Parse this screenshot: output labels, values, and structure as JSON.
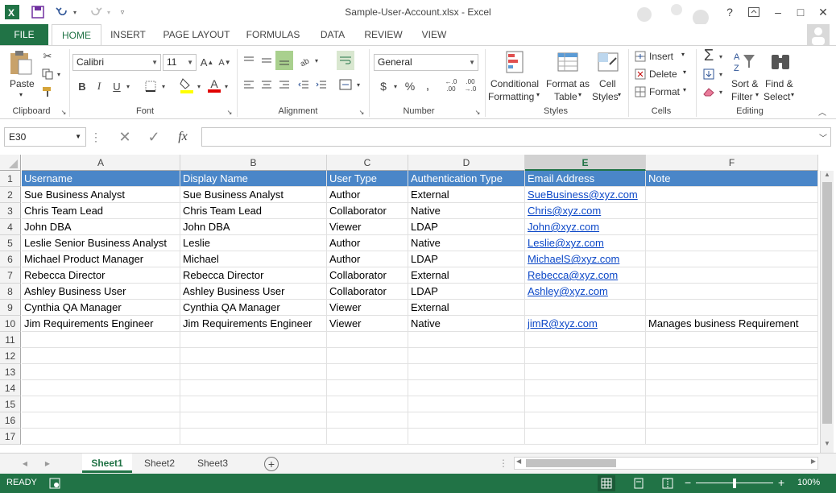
{
  "window": {
    "title": "Sample-User-Account.xlsx - Excel",
    "help_label": "?",
    "minimize_label": "–",
    "restore_label": "□",
    "close_label": "✕"
  },
  "qat": {
    "save_icon": "save-icon",
    "undo_icon": "undo-icon",
    "redo_icon": "redo-icon"
  },
  "ribbon_tabs": {
    "file": "FILE",
    "tabs": [
      "HOME",
      "INSERT",
      "PAGE LAYOUT",
      "FORMULAS",
      "DATA",
      "REVIEW",
      "VIEW"
    ]
  },
  "ribbon": {
    "clipboard": {
      "paste_label": "Paste",
      "group_label": "Clipboard"
    },
    "font": {
      "font_name": "Calibri",
      "font_size": "11",
      "bold": "B",
      "italic": "I",
      "underline": "U",
      "grow": "A",
      "shrink": "A",
      "font_color": "A",
      "group_label": "Font"
    },
    "alignment": {
      "group_label": "Alignment"
    },
    "number": {
      "format": "General",
      "currency": "$",
      "percent": "%",
      "comma": ",",
      "group_label": "Number"
    },
    "styles": {
      "conditional_line1": "Conditional",
      "conditional_line2": "Formatting",
      "format_table_line1": "Format as",
      "format_table_line2": "Table",
      "cell_styles_line1": "Cell",
      "cell_styles_line2": "Styles",
      "group_label": "Styles"
    },
    "cells": {
      "insert": "Insert",
      "delete": "Delete",
      "format": "Format",
      "group_label": "Cells"
    },
    "editing": {
      "sort_line1": "Sort &",
      "sort_line2": "Filter",
      "find_line1": "Find &",
      "find_line2": "Select",
      "group_label": "Editing"
    }
  },
  "formula_bar": {
    "name_box": "E30",
    "fx_label": "fx",
    "formula": ""
  },
  "grid": {
    "columns": [
      "A",
      "B",
      "C",
      "D",
      "E",
      "F"
    ],
    "selected_column": "E",
    "rows": [
      "1",
      "2",
      "3",
      "4",
      "5",
      "6",
      "7",
      "8",
      "9",
      "10",
      "11",
      "12",
      "13",
      "14",
      "15",
      "16",
      "17"
    ],
    "header_row": [
      "Username",
      "Display Name",
      "User Type",
      "Authentication Type",
      "Email Address",
      "Note"
    ],
    "data": [
      [
        "Sue Business Analyst",
        "Sue Business Analyst",
        "Author",
        "External",
        "SueBusiness@xyz.com",
        ""
      ],
      [
        "Chris Team Lead",
        "Chris Team Lead",
        "Collaborator",
        "Native",
        "Chris@xyz.com",
        ""
      ],
      [
        "John DBA",
        "John DBA",
        "Viewer",
        "LDAP",
        "John@xyz.com",
        ""
      ],
      [
        "Leslie Senior Business Analyst",
        "Leslie",
        "Author",
        "Native",
        "Leslie@xyz.com",
        ""
      ],
      [
        "Michael Product Manager",
        "Michael",
        "Author",
        "LDAP",
        "MichaelS@xyz.com",
        ""
      ],
      [
        "Rebecca Director",
        "Rebecca Director",
        "Collaborator",
        "External",
        "Rebecca@xyz.com",
        ""
      ],
      [
        "Ashley Business User",
        "Ashley Business User",
        "Collaborator",
        "LDAP",
        "Ashley@xyz.com",
        ""
      ],
      [
        "Cynthia QA Manager",
        "Cynthia QA Manager",
        "Viewer",
        "External",
        "",
        ""
      ],
      [
        "Jim Requirements Engineer",
        "Jim Requirements Engineer",
        "Viewer",
        "Native",
        "jimR@xyz.com",
        "Manages business Requirement"
      ]
    ]
  },
  "sheets": {
    "tabs": [
      "Sheet1",
      "Sheet2",
      "Sheet3"
    ],
    "active": "Sheet1",
    "add_label": "+"
  },
  "status": {
    "ready": "READY",
    "zoom": "100%"
  },
  "colors": {
    "accent": "#217346",
    "header_fill": "#4a86c8",
    "link": "#0b47c7"
  }
}
